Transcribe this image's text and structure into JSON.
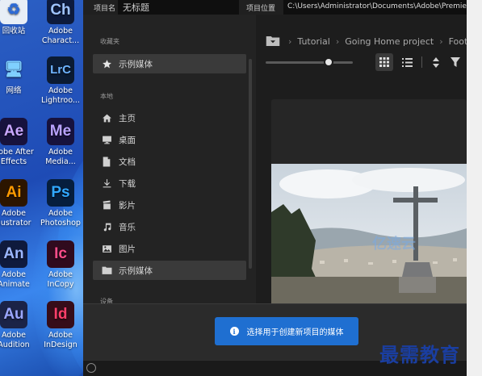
{
  "desktop": {
    "icons": [
      {
        "name": "recycle-bin",
        "label": "回收站",
        "glyph": "♻",
        "bg": "#e8eef6",
        "fg": "#2d6ad6"
      },
      {
        "name": "adobe-character",
        "label": "Adobe\nCharact...",
        "glyph": "Ch",
        "bg": "#0d1b3d",
        "fg": "#9ec3ff"
      },
      {
        "name": "network",
        "label": "网络",
        "glyph": "🖥",
        "bg": "transparent",
        "fg": "#7fd0ff"
      },
      {
        "name": "adobe-lightroom",
        "label": "Adobe\nLightroo...",
        "glyph": "LrC",
        "bg": "#0b1b33",
        "fg": "#6fb4ff"
      },
      {
        "name": "adobe-after-effects",
        "label": "dobe After\nEffects",
        "glyph": "Ae",
        "bg": "#17123d",
        "fg": "#c9a7ff"
      },
      {
        "name": "adobe-media-encoder",
        "label": "Adobe\nMedia...",
        "glyph": "Me",
        "bg": "#17123d",
        "fg": "#b8a2ff"
      },
      {
        "name": "adobe-illustrator",
        "label": "Adobe\nllustrator",
        "glyph": "Ai",
        "bg": "#2c1500",
        "fg": "#ff9a00"
      },
      {
        "name": "adobe-photoshop",
        "label": "Adobe\nPhotoshop",
        "glyph": "Ps",
        "bg": "#061e3d",
        "fg": "#31a8ff"
      },
      {
        "name": "adobe-animate",
        "label": "Adobe\nAnimate",
        "glyph": "An",
        "bg": "#0f1a3d",
        "fg": "#9bb6ff"
      },
      {
        "name": "adobe-incopy",
        "label": "Adobe\nInCopy",
        "glyph": "Ic",
        "bg": "#300b1e",
        "fg": "#ff4d8a"
      },
      {
        "name": "adobe-audition",
        "label": "Adobe\nAudition",
        "glyph": "Au",
        "bg": "#1b2347",
        "fg": "#9aa6ff"
      },
      {
        "name": "adobe-indesign",
        "label": "Adobe\nInDesign",
        "glyph": "Id",
        "bg": "#360d19",
        "fg": "#ff3f6a"
      }
    ]
  },
  "window": {
    "project_name_label": "项目名",
    "project_name_value": "无标题",
    "project_location_label": "项目位置",
    "project_location_value": "C:\\Users\\Administrator\\Documents\\Adobe\\Premiere P"
  },
  "sidebar": {
    "favorites_heading": "收藏夹",
    "favorites": [
      {
        "label": "示例媒体",
        "icon": "star-icon"
      }
    ],
    "local_heading": "本地",
    "local": [
      {
        "label": "主页",
        "icon": "home-icon"
      },
      {
        "label": "桌面",
        "icon": "monitor-icon"
      },
      {
        "label": "文档",
        "icon": "document-icon"
      },
      {
        "label": "下载",
        "icon": "download-icon"
      },
      {
        "label": "影片",
        "icon": "film-icon"
      },
      {
        "label": "音乐",
        "icon": "music-icon"
      },
      {
        "label": "图片",
        "icon": "image-icon"
      },
      {
        "label": "示例媒体",
        "icon": "folder-icon"
      }
    ],
    "devices_heading": "设备"
  },
  "browser": {
    "breadcrumb": [
      "Tutorial",
      "Going Home project",
      "Footage"
    ]
  },
  "footer": {
    "select_button": "选择用于创建新项目的媒体"
  },
  "watermark": {
    "logo_text": "最需教育",
    "stamp_text": "亿速云"
  },
  "colors": {
    "accent": "#1f6fd1",
    "panel": "#1d1d1d",
    "sidebar": "#232323"
  }
}
